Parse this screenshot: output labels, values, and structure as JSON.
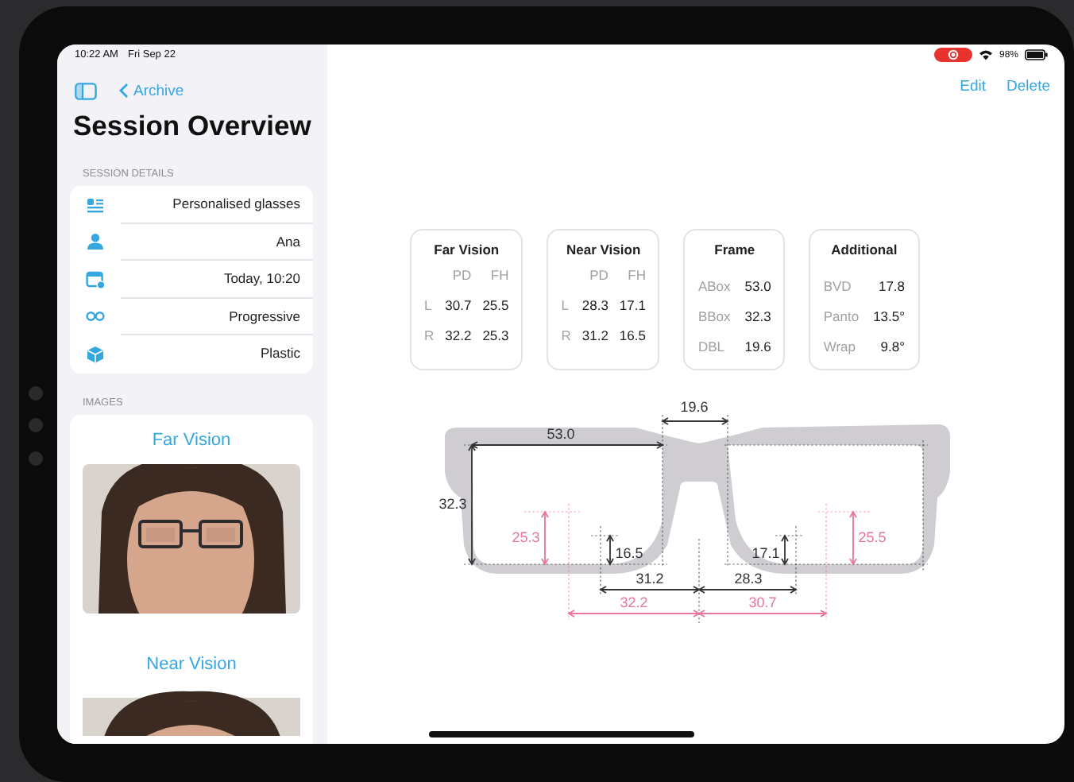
{
  "status_bar": {
    "time": "10:22 AM",
    "date": "Fri Sep 22",
    "battery": "98%"
  },
  "sidebar": {
    "back_link": "Archive",
    "title": "Session Overview",
    "details_heading": "SESSION DETAILS",
    "details": [
      {
        "kind": "type",
        "value": "Personalised glasses"
      },
      {
        "kind": "person",
        "value": "Ana"
      },
      {
        "kind": "date",
        "value": "Today, 10:20"
      },
      {
        "kind": "lens",
        "value": "Progressive"
      },
      {
        "kind": "material",
        "value": "Plastic"
      }
    ],
    "images_heading": "IMAGES",
    "images": [
      {
        "title": "Far Vision",
        "kind": "picture"
      },
      {
        "title": "Near Vision",
        "kind": "picture"
      }
    ]
  },
  "toolbar": {
    "buttons": [
      "Edit",
      "Delete"
    ]
  },
  "cards": [
    {
      "title": "Far Vision",
      "columns": [
        "PD",
        "FH"
      ],
      "rows": [
        {
          "label": "L",
          "values": [
            "30.7",
            "25.5"
          ]
        },
        {
          "label": "R",
          "values": [
            "32.2",
            "25.3"
          ]
        }
      ]
    },
    {
      "title": "Near Vision",
      "columns": [
        "PD",
        "FH"
      ],
      "rows": [
        {
          "label": "L",
          "values": [
            "28.3",
            "17.1"
          ]
        },
        {
          "label": "R",
          "values": [
            "31.2",
            "16.5"
          ]
        }
      ]
    },
    {
      "title": "Frame",
      "rows": [
        {
          "label": "ABox",
          "values": [
            "53.0"
          ]
        },
        {
          "label": "BBox",
          "values": [
            "32.3"
          ]
        },
        {
          "label": "DBL",
          "values": [
            "19.6"
          ]
        }
      ]
    },
    {
      "title": "Additional",
      "rows": [
        {
          "label": "BVD",
          "values": [
            "17.8"
          ]
        },
        {
          "label": "Panto",
          "values": [
            "13.5°"
          ]
        },
        {
          "label": "Wrap",
          "values": [
            "9.8°"
          ]
        }
      ]
    }
  ],
  "diagram": {
    "measurements": [
      {
        "kind": "bridge",
        "value": "19.6"
      },
      {
        "kind": "box_width",
        "value": "53.0"
      },
      {
        "kind": "box_height",
        "value": "32.3"
      },
      {
        "kind": "far_fh_right",
        "value": "25.3"
      },
      {
        "kind": "near_fh_right",
        "value": "16.5"
      },
      {
        "kind": "near_fh_left",
        "value": "17.1"
      },
      {
        "kind": "far_fh_left",
        "value": "25.5"
      },
      {
        "kind": "near_pd_right",
        "value": "31.2"
      },
      {
        "kind": "near_pd_left",
        "value": "28.3"
      },
      {
        "kind": "far_pd_right",
        "value": "32.2"
      },
      {
        "kind": "far_pd_left",
        "value": "30.7"
      }
    ]
  }
}
